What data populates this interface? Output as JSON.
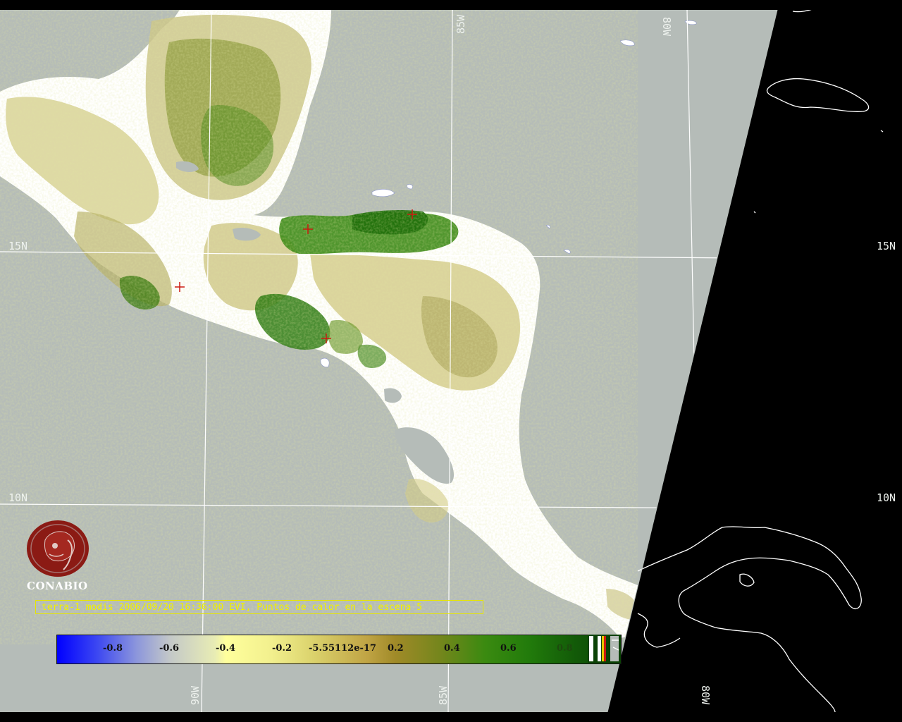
{
  "caption": "terra-1 modis 2006/09/20 16:36:00 EVI, Puntos de calor en la escena 5",
  "logo_text": "CONABIO",
  "grid_labels": {
    "lon_85w_top": "85W",
    "lon_80w_top": "80W",
    "lon_90w_bottom": "90W",
    "lon_85w_bottom": "85W",
    "lon_80w_bottom": "80W",
    "lat_15n_left": "15N",
    "lat_15n_right": "15N",
    "lat_10n_left": "10N",
    "lat_10n_right": "10N"
  },
  "colorbar": {
    "labels": [
      "-0.8",
      "-0.6",
      "-0.4",
      "-0.2",
      "-5.55112e-17",
      "0.2",
      "0.4",
      "0.6",
      "0.8"
    ],
    "colors": [
      "#0000ff",
      "#ffff9c",
      "#c0a444",
      "#217a0b",
      "#0b4205"
    ]
  },
  "colors": {
    "ocean": "#b5bcb8",
    "outside_swath": "#000000",
    "cloud": "#ffffff",
    "grid": "#ffffff",
    "hotspot": "#cc1a10",
    "caption": "#f0f000"
  }
}
